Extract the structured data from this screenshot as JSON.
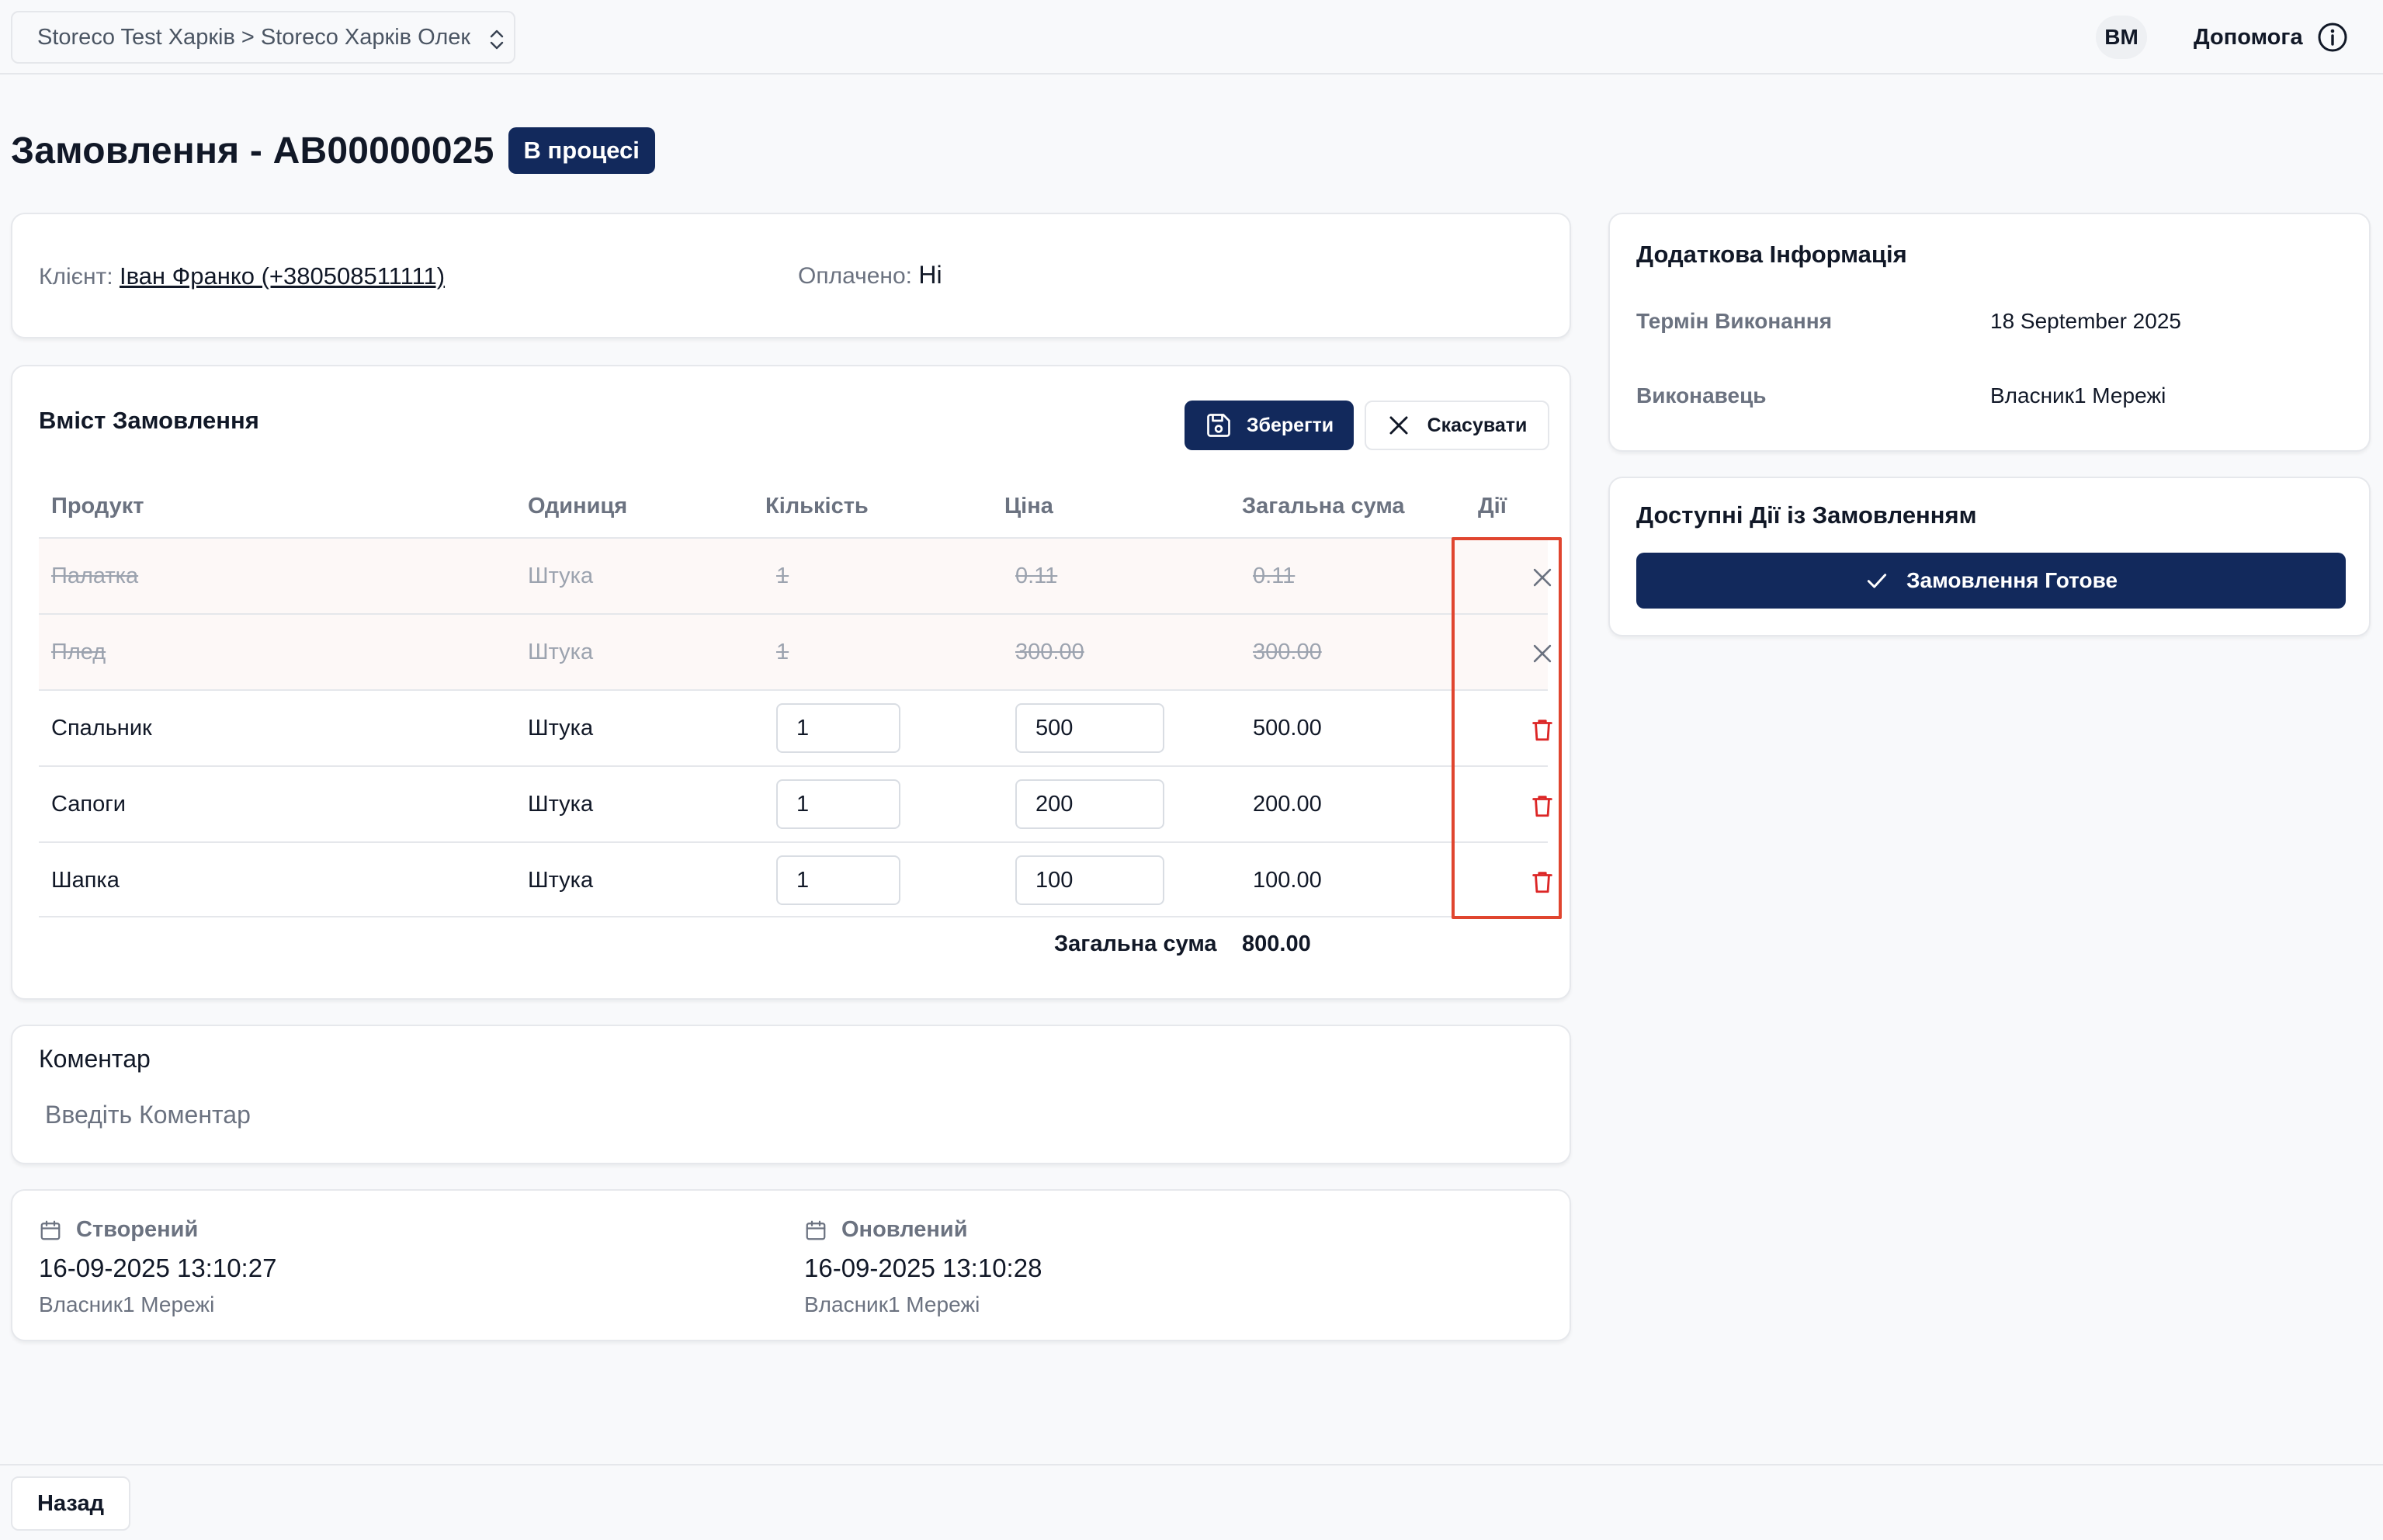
{
  "header": {
    "store_path": "Storeco Test Харків > Storeco Харків Олек",
    "avatar_initials": "ВМ",
    "help_label": "Допомога"
  },
  "order": {
    "title": "Замовлення - AB00000025",
    "status": "В процесі"
  },
  "client_card": {
    "client_label": "Клієнт:",
    "client_value": "Іван Франко (+380508511111)",
    "paid_label": "Оплачено:",
    "paid_value": "Ні"
  },
  "order_contents": {
    "title": "Вміст Замовлення",
    "save_label": "Зберегти",
    "cancel_label": "Скасувати",
    "columns": [
      "Продукт",
      "Одиниця",
      "Кількість",
      "Ціна",
      "Загальна сума",
      "Дії"
    ],
    "rows": [
      {
        "product": "Палатка",
        "unit": "Штука",
        "qty": "1",
        "price": "0.11",
        "total": "0.11",
        "removed": true,
        "action": "restore-x-icon"
      },
      {
        "product": "Плед",
        "unit": "Штука",
        "qty": "1",
        "price": "300.00",
        "total": "300.00",
        "removed": true,
        "action": "restore-x-icon"
      },
      {
        "product": "Спальник",
        "unit": "Штука",
        "qty": "1",
        "price": "500",
        "total": "500.00",
        "removed": false,
        "action": "trash-icon"
      },
      {
        "product": "Сапоги",
        "unit": "Штука",
        "qty": "1",
        "price": "200",
        "total": "200.00",
        "removed": false,
        "action": "trash-icon"
      },
      {
        "product": "Шапка",
        "unit": "Штука",
        "qty": "1",
        "price": "100",
        "total": "100.00",
        "removed": false,
        "action": "trash-icon"
      }
    ],
    "grand_total_label": "Загальна сума",
    "grand_total_value": "800.00"
  },
  "comment": {
    "title": "Коментар",
    "placeholder": "Введіть Коментар"
  },
  "meta": {
    "created_label": "Створений",
    "created_date": "16-09-2025 13:10:27",
    "created_by": "Власник1 Мережі",
    "updated_label": "Оновлений",
    "updated_date": "16-09-2025 13:10:28",
    "updated_by": "Власник1 Мережі"
  },
  "additional_info": {
    "title": "Додаткова Інформація",
    "deadline_label": "Термін Виконання",
    "deadline_value": "18 September 2025",
    "executor_label": "Виконавець",
    "executor_value": "Власник1 Мережі"
  },
  "available_actions": {
    "title": "Доступні Дії із Замовленням",
    "ready_label": "Замовлення Готове"
  },
  "footer": {
    "back_label": "Назад"
  },
  "colors": {
    "primary": "#12295c",
    "danger": "#dc2626",
    "highlight": "#e0452f",
    "muted_text": "#6b7280"
  }
}
